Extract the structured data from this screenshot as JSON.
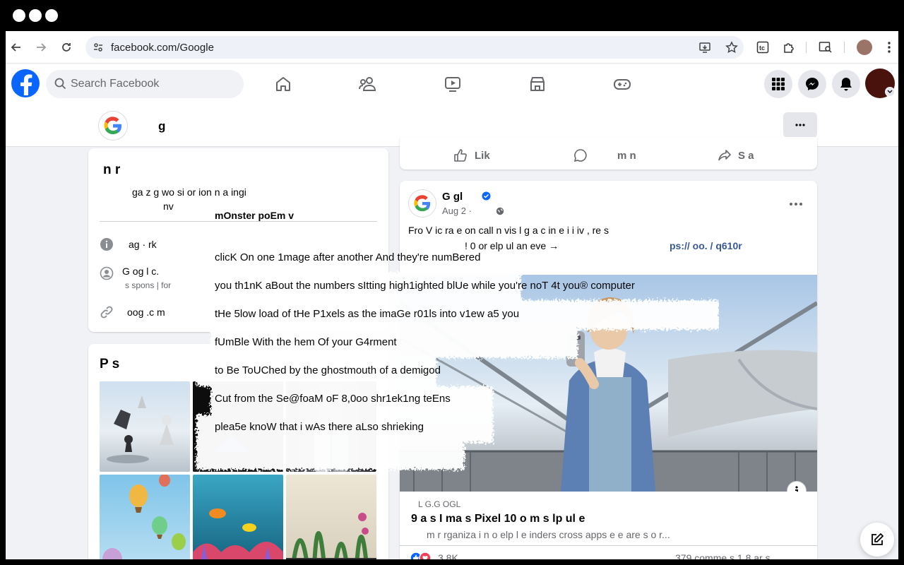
{
  "browser": {
    "url": "facebook.com/Google"
  },
  "facebook": {
    "search_placeholder": "Search Facebook"
  },
  "page_header": {
    "name": "g"
  },
  "intro_card": {
    "title": "n r",
    "bio_line1": "ga z g     wo     si   or      ion  n     a ingi",
    "bio_line2": "nv",
    "items": [
      {
        "icon": "info-icon",
        "text": "ag    ·    rk"
      },
      {
        "icon": "verified-person-icon",
        "text": "G  og    l c.",
        "sub": "s    spons  |  for"
      },
      {
        "icon": "link-icon",
        "text": "oog  .c  m"
      }
    ]
  },
  "photos_card": {
    "title": "P       s"
  },
  "prev_post_actions": {
    "like": "Lik",
    "comment": "m  n",
    "share": "S  a"
  },
  "post": {
    "author": "G   gl",
    "date": "Aug     2  ·",
    "text_line1": "Fro   V  ic    ra         e on          call       n    vis    l g     a   c   in    e   i   i  iv ,     re s",
    "text_line2": "!  0     or      elp ul    an eve →",
    "link": "ps://  oo.    /    q610r",
    "link_source": "L  G.G   OGL",
    "link_title": "9    a  s    I ma    s Pixel 10 o     m  s       lp  ul           e",
    "link_desc": "m       r     rganiza i  n  o   elp    l   e   inders   cross apps     e  e are         s   o  r...",
    "reactions_count": "3.8K",
    "comments_shares": "379 comme     s  1  8      ar  s"
  },
  "poem": [
    "mOnster poEm v",
    "clicK On one 1mage after another And they're numBered",
    "you th1nK aBout the numbers sItting high1ighted blUe while you're noT 4t you® computer",
    "tHe 5low load of tHe P1xels as the imaGe r01ls into v1ew a5 you",
    "fUmBle With the hem Of your G4rment",
    "to Be ToUChed by the ghostmouth of a demigod",
    "Cut from the Se@foaM oF 8,0oo shr1ek1ng teEns",
    "plea5e knoW that i wAs there aLso shrieking"
  ],
  "colors": {
    "facebook_blue": "#0866ff",
    "link_blue": "#385898"
  }
}
